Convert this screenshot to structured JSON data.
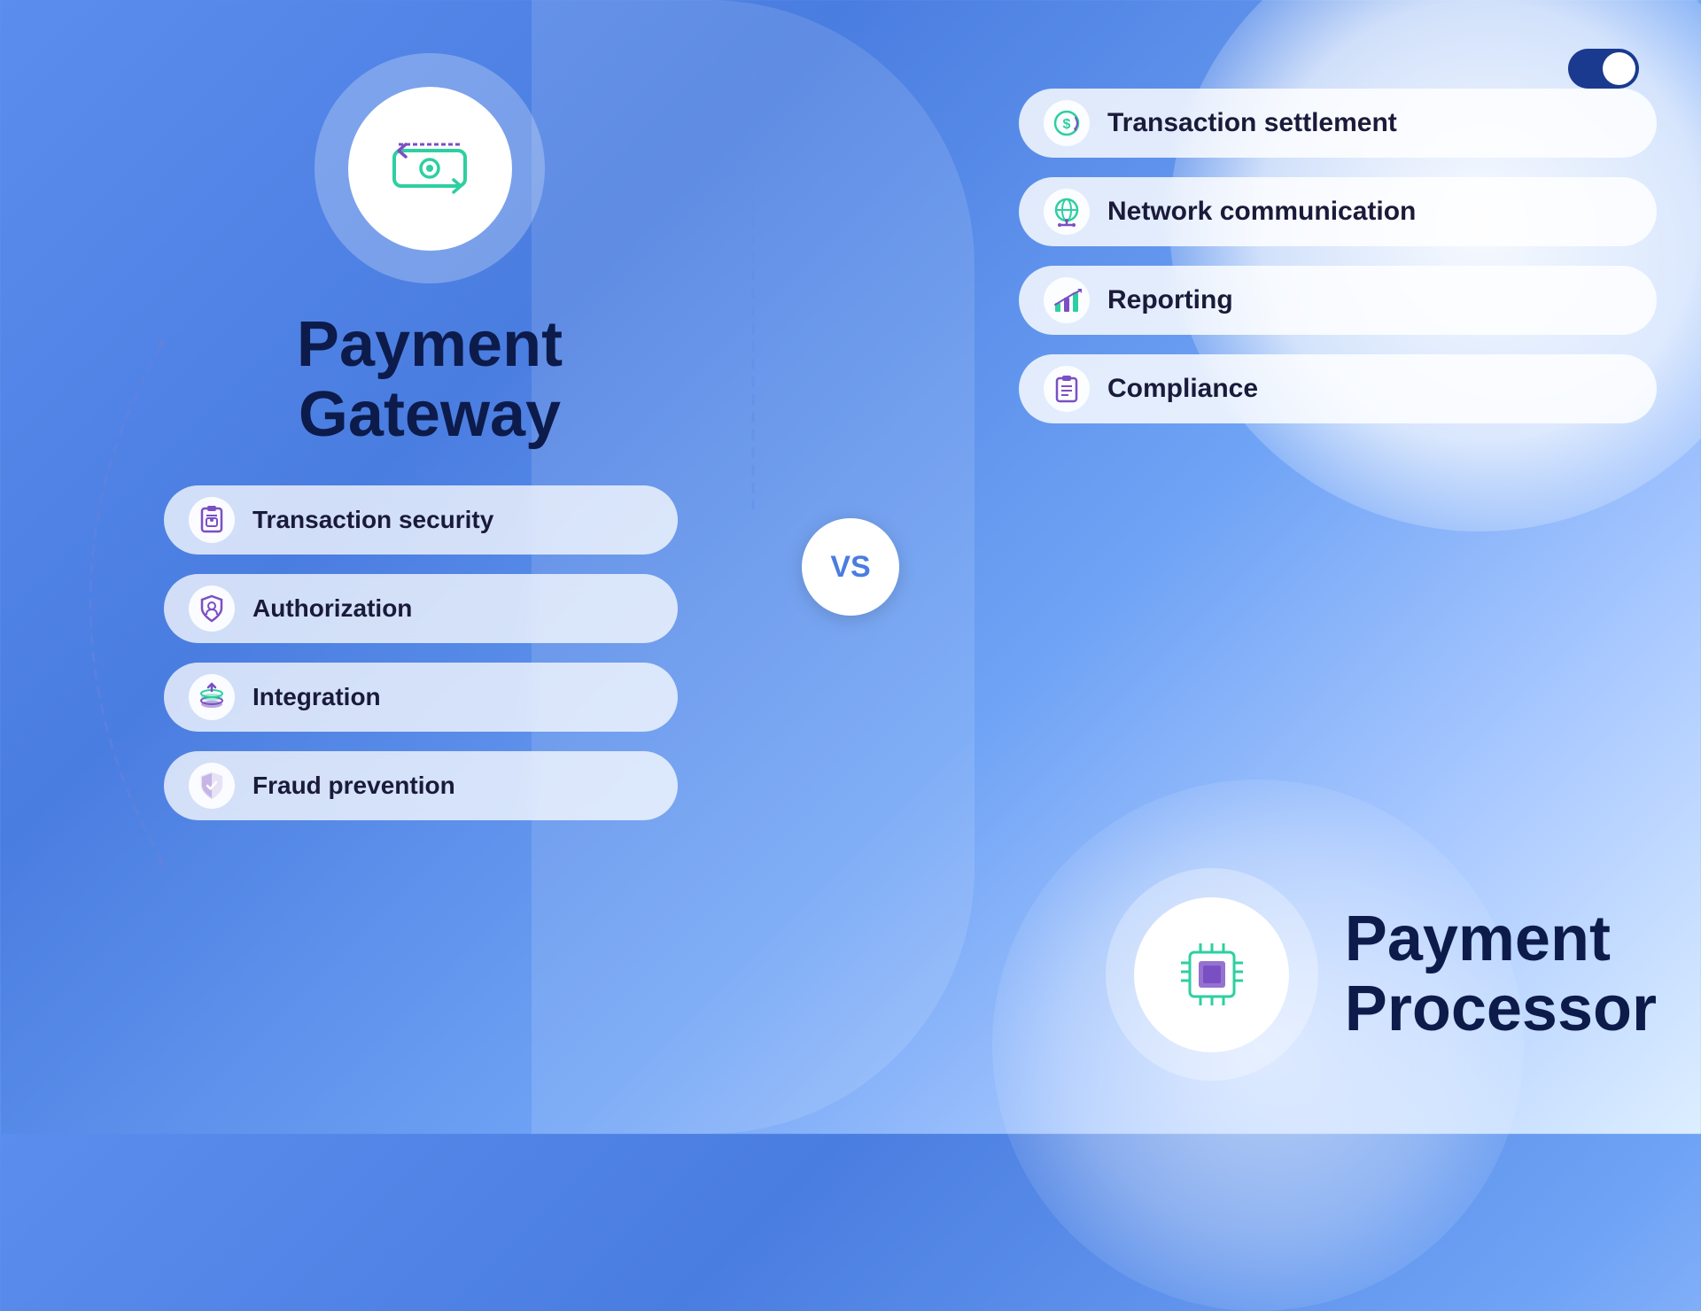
{
  "toggle": {
    "label": "toggle-on"
  },
  "left": {
    "title_line1": "Payment",
    "title_line2": "Gateway",
    "features": [
      {
        "id": "transaction-security",
        "label": "Transaction security",
        "icon": "clipboard-lock"
      },
      {
        "id": "authorization",
        "label": "Authorization",
        "icon": "shield-check"
      },
      {
        "id": "integration",
        "label": "Integration",
        "icon": "stack-coins"
      },
      {
        "id": "fraud-prevention",
        "label": "Fraud prevention",
        "icon": "shield-half"
      }
    ]
  },
  "vs": "VS",
  "right": {
    "features": [
      {
        "id": "transaction-settlement",
        "label": "Transaction settlement",
        "icon": "dollar-cycle"
      },
      {
        "id": "network-communication",
        "label": "Network communication",
        "icon": "globe-network"
      },
      {
        "id": "reporting",
        "label": "Reporting",
        "icon": "bar-chart"
      },
      {
        "id": "compliance",
        "label": "Compliance",
        "icon": "clipboard-list"
      }
    ],
    "title_line1": "Payment",
    "title_line2": "Processor"
  }
}
